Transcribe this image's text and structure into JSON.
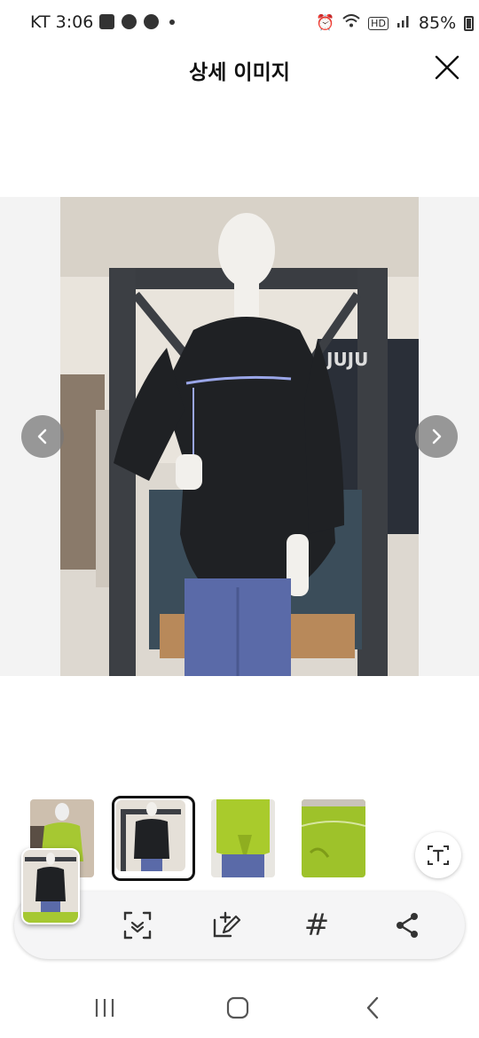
{
  "status_bar": {
    "carrier_time": "KT 3:06",
    "battery": "85%",
    "network": "HD"
  },
  "header": {
    "title": "상세 이미지"
  },
  "icons": {
    "close": "close-icon",
    "prev": "chevron-left-icon",
    "next": "chevron-right-icon",
    "text_extract": "text-extract-icon",
    "scan": "scan-icon",
    "edit": "edit-icon",
    "tag": "hashtag-icon",
    "share": "share-icon"
  },
  "thumbnails": {
    "selected_index": 1
  },
  "toolbar": {
    "tag_symbol": "#"
  },
  "colors": {
    "overlay_button": "#7a7a7a",
    "toolbar_bg": "#f5f5f6",
    "lime": "#9ec22a"
  }
}
